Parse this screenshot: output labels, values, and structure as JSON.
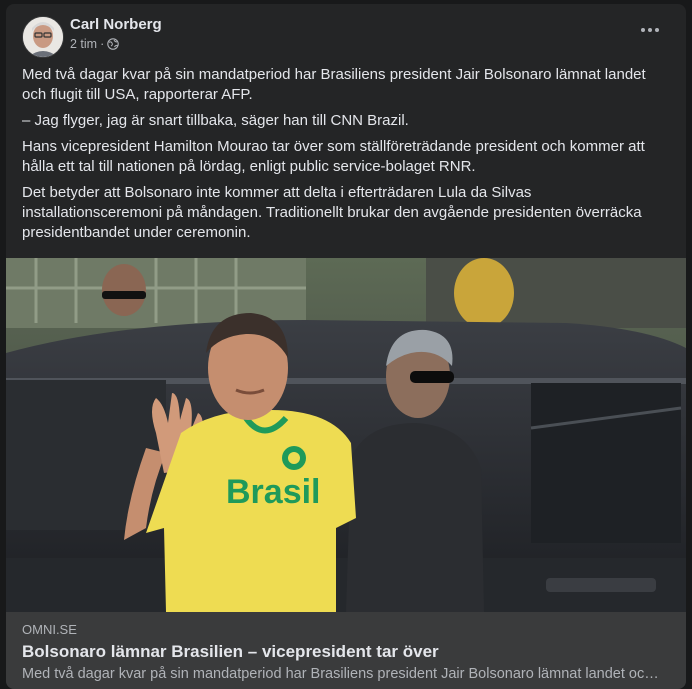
{
  "post": {
    "author": "Carl Norberg",
    "time": "2 tim",
    "separator": "·",
    "privacy_icon": "globe-icon",
    "menu_icon": "more-horizontal-icon",
    "paragraphs": [
      "Med två dagar kvar på sin mandatperiod har Brasiliens president Jair Bolsonaro lämnat landet och flugit till USA, rapporterar AFP.",
      "– Jag flyger, jag är snart tillbaka, säger han till CNN Brazil.",
      "Hans vicepresident Hamilton Mourao tar över som ställföreträdande president och kommer att hålla ett tal till nationen på lördag, enligt public service-bolaget RNR.",
      "Det betyder att Bolsonaro inte kommer att delta i efterträdaren Lula da Silvas installationsceremoni på måndagen. Traditionellt brukar den avgående presidenten överräcka presidentbandet under ceremonin."
    ]
  },
  "photo": {
    "shirt_text": "Brasil"
  },
  "link": {
    "domain": "OMNI.SE",
    "title": "Bolsonaro lämnar Brasilien – vicepresident tar över",
    "description": "Med två dagar kvar på sin mandatperiod har Brasiliens president Jair Bolsonaro lämnat landet och flugit till USA, rapporterar AFP."
  },
  "colors": {
    "background": "#18191a",
    "card": "#242526",
    "link_box": "#3a3b3c",
    "primary_text": "#e4e6eb",
    "secondary_text": "#b0b3b8",
    "shirt_yellow": "#eedc52",
    "shirt_green": "#1f9a5a"
  }
}
